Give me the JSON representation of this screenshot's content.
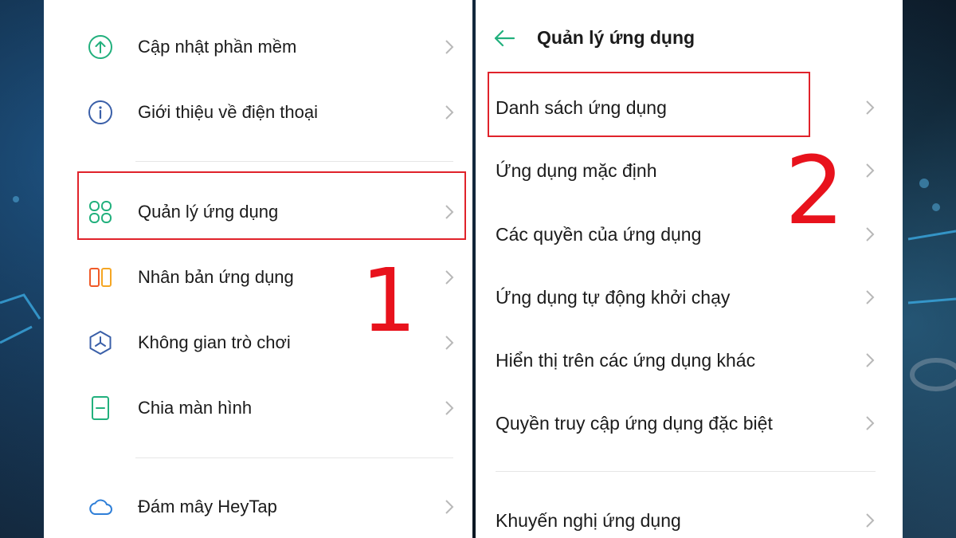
{
  "left_panel": {
    "items": [
      {
        "label": "Cập nhật phần mềm",
        "icon": "arrow-up-circle-icon"
      },
      {
        "label": "Giới thiệu về điện thoại",
        "icon": "info-icon"
      },
      {
        "label": "Quản lý ứng dụng",
        "icon": "app-grid-icon"
      },
      {
        "label": "Nhân bản ứng dụng",
        "icon": "clone-icon"
      },
      {
        "label": "Không gian trò chơi",
        "icon": "game-space-icon"
      },
      {
        "label": "Chia màn hình",
        "icon": "split-screen-icon"
      },
      {
        "label": "Đám mây HeyTap",
        "icon": "cloud-icon"
      }
    ],
    "step_number": "1"
  },
  "right_panel": {
    "title": "Quản lý ứng dụng",
    "items": [
      {
        "label": "Danh sách ứng dụng"
      },
      {
        "label": "Ứng dụng mặc định"
      },
      {
        "label": "Các quyền của ứng dụng"
      },
      {
        "label": "Ứng dụng tự động khởi chạy"
      },
      {
        "label": "Hiển thị trên các ứng dụng khác"
      },
      {
        "label": "Quyền truy cập ứng dụng đặc biệt"
      },
      {
        "label": "Khuyến nghị ứng dụng"
      }
    ],
    "step_number": "2"
  },
  "colors": {
    "accent_green": "#22b07d",
    "highlight_red": "#e0232b",
    "step_red": "#e8121c"
  }
}
